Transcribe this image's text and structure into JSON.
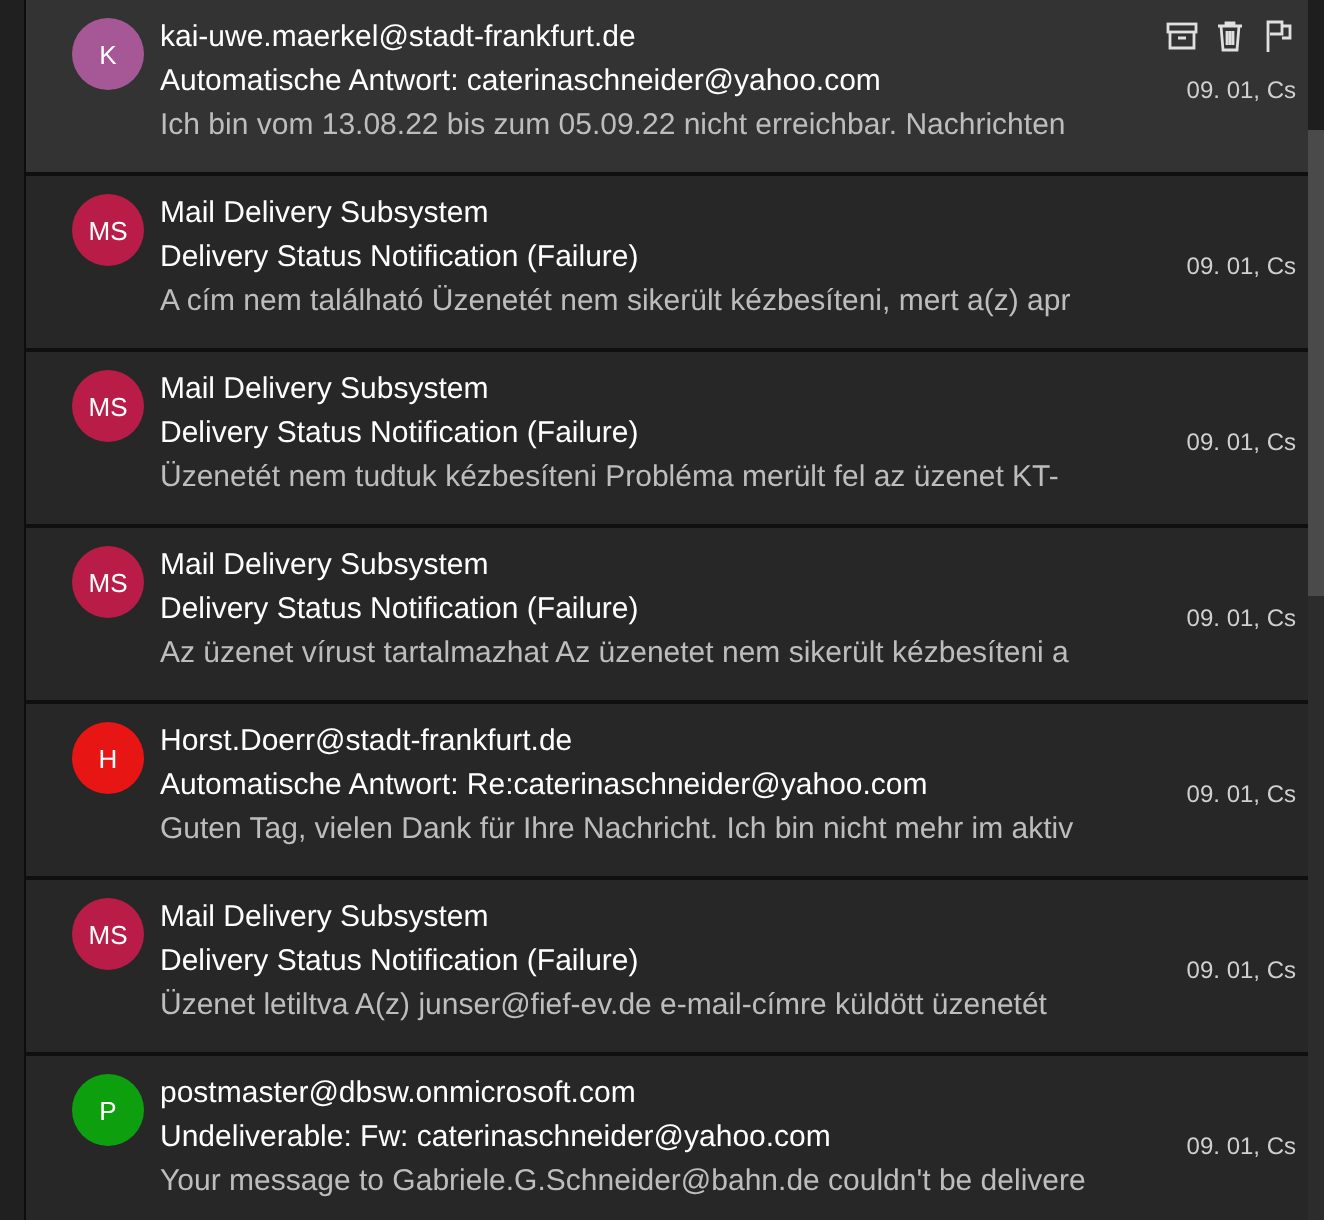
{
  "messages": [
    {
      "initials": "K",
      "color": "#a55796",
      "sender": "kai-uwe.maerkel@stadt-frankfurt.de",
      "subject": "Automatische Antwort: caterinaschneider@yahoo.com",
      "preview": "Ich bin vom 13.08.22 bis zum 05.09.22 nicht erreichbar. Nachrichten",
      "date": "09. 01, Cs",
      "hovered": true
    },
    {
      "initials": "MS",
      "color": "#b91c47",
      "sender": "Mail Delivery Subsystem",
      "subject": "Delivery Status Notification (Failure)",
      "preview": "A cím nem található Üzenetét nem sikerült kézbesíteni, mert a(z) apr",
      "date": "09. 01, Cs",
      "hovered": false
    },
    {
      "initials": "MS",
      "color": "#b91c47",
      "sender": "Mail Delivery Subsystem",
      "subject": "Delivery Status Notification (Failure)",
      "preview": "Üzenetét nem tudtuk kézbesíteni Probléma merült fel az üzenet KT-",
      "date": "09. 01, Cs",
      "hovered": false
    },
    {
      "initials": "MS",
      "color": "#b91c47",
      "sender": "Mail Delivery Subsystem",
      "subject": "Delivery Status Notification (Failure)",
      "preview": "Az üzenet vírust tartalmazhat Az üzenetet nem sikerült kézbesíteni a",
      "date": "09. 01, Cs",
      "hovered": false
    },
    {
      "initials": "H",
      "color": "#e81515",
      "sender": "Horst.Doerr@stadt-frankfurt.de",
      "subject": "Automatische Antwort: Re:caterinaschneider@yahoo.com",
      "preview": "Guten Tag, vielen Dank für Ihre Nachricht. Ich bin nicht mehr im aktiv",
      "date": "09. 01, Cs",
      "hovered": false
    },
    {
      "initials": "MS",
      "color": "#b91c47",
      "sender": "Mail Delivery Subsystem",
      "subject": "Delivery Status Notification (Failure)",
      "preview": "Üzenet letiltva A(z) junser@fief-ev.de e-mail-címre küldött üzenetét",
      "date": "09. 01, Cs",
      "hovered": false
    },
    {
      "initials": "P",
      "color": "#0e9f0e",
      "sender": "postmaster@dbsw.onmicrosoft.com",
      "subject": "Undeliverable: Fw: caterinaschneider@yahoo.com",
      "preview": "Your message to Gabriele.G.Schneider@bahn.de couldn't be delivere",
      "date": "09. 01, Cs",
      "hovered": false
    }
  ]
}
